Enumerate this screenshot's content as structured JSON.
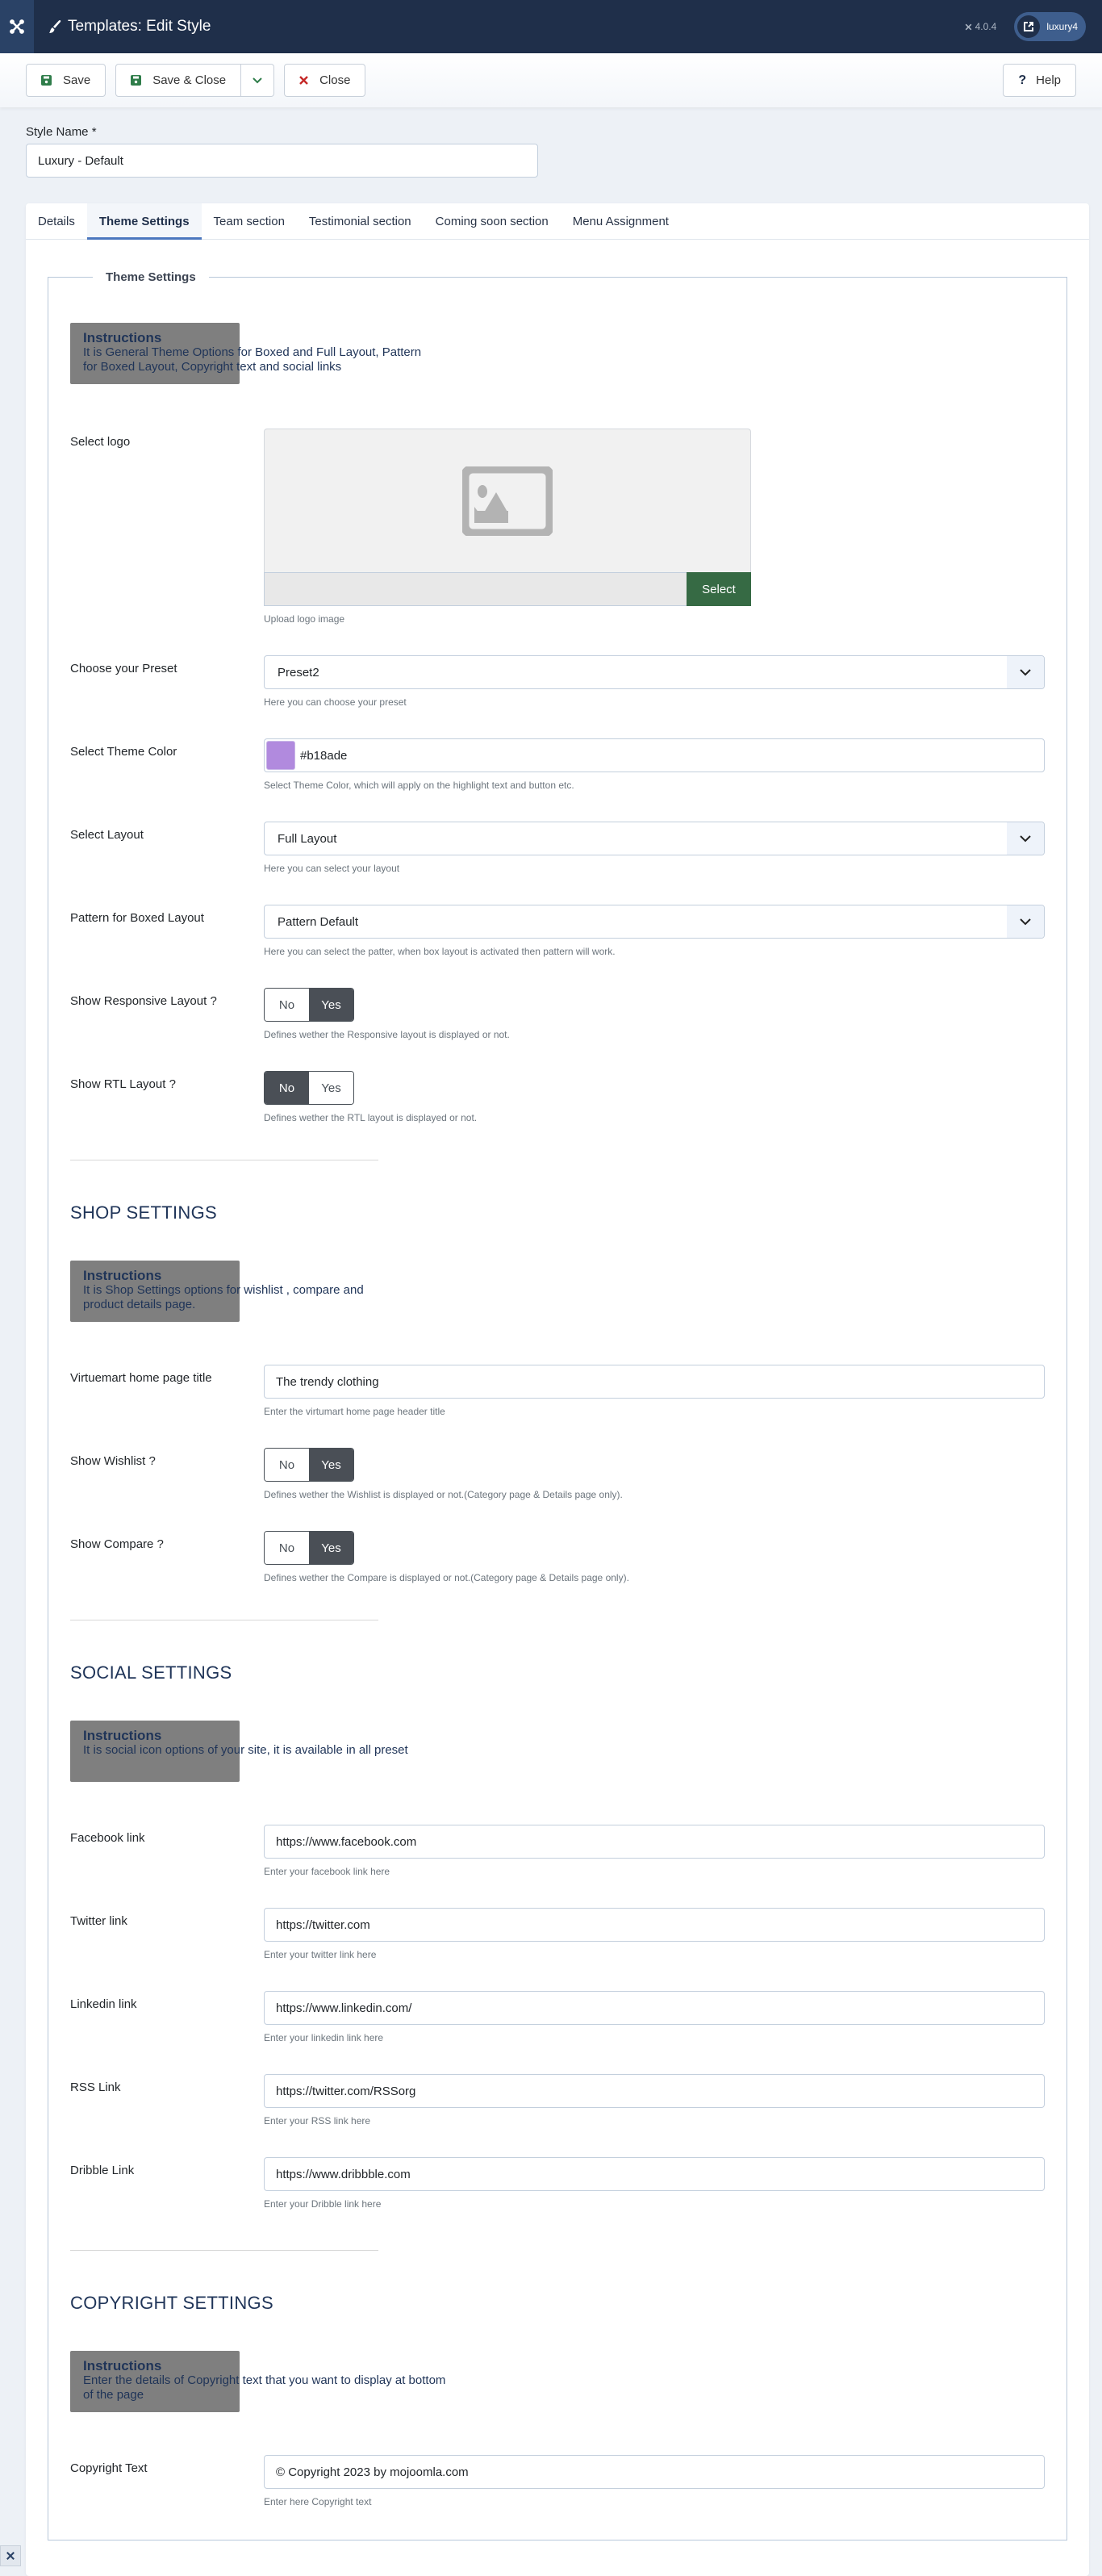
{
  "header": {
    "title": "Templates: Edit Style",
    "version": "4.0.4",
    "site_name": "luxury4",
    "icons": {
      "brand": "joomla-logo-icon",
      "title": "paint-brush-icon",
      "site": "external-link-icon"
    }
  },
  "toolbar": {
    "save_label": "Save",
    "save_close_label": "Save & Close",
    "close_label": "Close",
    "help_label": "Help",
    "colors": {
      "save_icon": "#2f7d4a",
      "close_icon": "#c52827"
    }
  },
  "style_name": {
    "label": "Style Name *",
    "value": "Luxury - Default"
  },
  "tabs": [
    {
      "label": "Details",
      "active": false
    },
    {
      "label": "Theme Settings",
      "active": true
    },
    {
      "label": "Team section",
      "active": false
    },
    {
      "label": "Testimonial section",
      "active": false
    },
    {
      "label": "Coming soon section",
      "active": false
    },
    {
      "label": "Menu Assignment",
      "active": false
    }
  ],
  "fieldset_legend": "Theme Settings",
  "theme": {
    "instructions": {
      "title": "Instructions",
      "text": "It is General Theme Options for Boxed and Full Layout, Pattern for Boxed Layout, Copyright text and social links"
    },
    "logo": {
      "label": "Select logo",
      "select_label": "Select",
      "hint": "Upload logo image",
      "path_value": ""
    },
    "preset": {
      "label": "Choose your Preset",
      "value": "Preset2",
      "hint": "Here you can choose your preset"
    },
    "theme_color": {
      "label": "Select Theme Color",
      "value": "#b18ade",
      "hint": "Select Theme Color, which will apply on the highlight text and button etc."
    },
    "layout": {
      "label": "Select Layout",
      "value": "Full Layout",
      "hint": "Here you can select your layout"
    },
    "pattern": {
      "label": "Pattern for Boxed Layout",
      "value": "Pattern Default",
      "hint": "Here you can select the patter, when box layout is activated then pattern will work."
    },
    "responsive": {
      "label": "Show Responsive Layout ?",
      "no": "No",
      "yes": "Yes",
      "selected": "Yes",
      "hint": "Defines wether the Responsive layout is displayed or not."
    },
    "rtl": {
      "label": "Show RTL Layout ?",
      "no": "No",
      "yes": "Yes",
      "selected": "No",
      "hint": "Defines wether the RTL layout is displayed or not."
    }
  },
  "shop": {
    "title": "SHOP SETTINGS",
    "instructions": {
      "title": "Instructions",
      "text": "It is Shop Settings options for wishlist , compare and product details page."
    },
    "home_title": {
      "label": "Virtuemart home page title",
      "value": "The trendy clothing",
      "hint": "Enter the virtumart home page header title"
    },
    "wishlist": {
      "label": "Show Wishlist ?",
      "no": "No",
      "yes": "Yes",
      "selected": "Yes",
      "hint": "Defines wether the Wishlist is displayed or not.(Category page & Details page only)."
    },
    "compare": {
      "label": "Show Compare ?",
      "no": "No",
      "yes": "Yes",
      "selected": "Yes",
      "hint": "Defines wether the Compare is displayed or not.(Category page & Details page only)."
    }
  },
  "social": {
    "title": "SOCIAL SETTINGS",
    "instructions": {
      "title": "Instructions",
      "text": "It is social icon options of your site, it is available in all preset"
    },
    "links": [
      {
        "label": "Facebook link",
        "value": "https://www.facebook.com",
        "hint": "Enter your facebook link here"
      },
      {
        "label": "Twitter link",
        "value": "https://twitter.com",
        "hint": "Enter your twitter link here"
      },
      {
        "label": "Linkedin link",
        "value": "https://www.linkedin.com/",
        "hint": "Enter your linkedin link here"
      },
      {
        "label": "RSS Link",
        "value": "https://twitter.com/RSSorg",
        "hint": "Enter your RSS link here"
      },
      {
        "label": "Dribble Link",
        "value": "https://www.dribbble.com",
        "hint": "Enter your Dribble link here"
      }
    ]
  },
  "copyright": {
    "title": "COPYRIGHT SETTINGS",
    "instructions": {
      "title": "Instructions",
      "text": "Enter the details of Copyright text that you want to display at bottom of the page"
    },
    "field": {
      "label": "Copyright Text",
      "value": "© Copyright 2023 by mojoomla.com",
      "hint": "Enter here Copyright text"
    }
  }
}
